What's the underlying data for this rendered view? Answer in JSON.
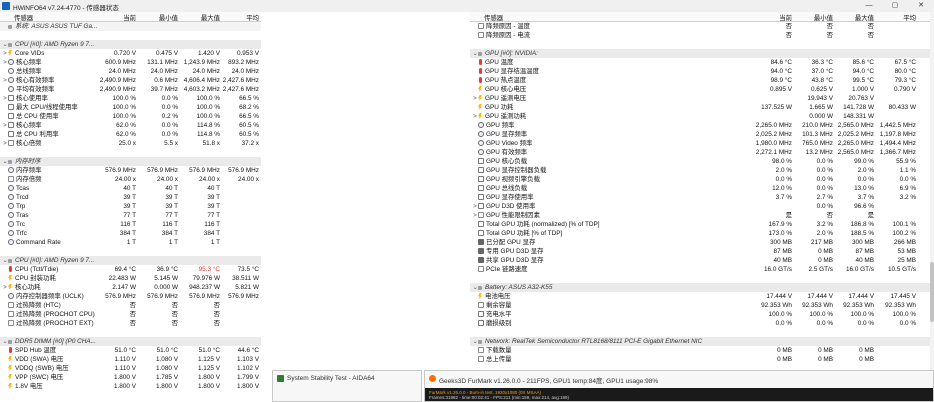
{
  "window": {
    "title": "HWiNFO64 v7.24-4770 - 传感器状态",
    "minimize": "—",
    "maximize": "▢",
    "close": "✕"
  },
  "columns": {
    "name": "传感器",
    "current": "当前",
    "min": "最小值",
    "max": "最大值",
    "avg": "平均"
  },
  "left_rows": [
    {
      "type": "group",
      "first": true,
      "icon": "computer-icon",
      "name": "系统: ASUS ASUS TUF Ga..."
    },
    {
      "type": "gap"
    },
    {
      "type": "group",
      "icon": "cpu-icon",
      "name": "CPU [#0]: AMD Ryzen 9 7...",
      "expander": "⌄"
    },
    {
      "type": "row",
      "indent": 1,
      "expander": ">",
      "icon": "bolt",
      "name": "Core VIDs",
      "v": [
        "0.720 V",
        "0.475 V",
        "1.420 V",
        "0.953 V"
      ]
    },
    {
      "type": "row",
      "indent": 1,
      "expander": ">",
      "icon": "clock",
      "name": "核心频率",
      "v": [
        "600.9 MHz",
        "131.1 MHz",
        "1,243.9 MHz",
        "893.2 MHz"
      ]
    },
    {
      "type": "row",
      "icon": "clock",
      "name": "总线频率",
      "v": [
        "24.0 MHz",
        "24.0 MHz",
        "24.0 MHz",
        "24.0 MHz"
      ]
    },
    {
      "type": "row",
      "indent": 1,
      "expander": ">",
      "icon": "clock",
      "name": "核心有效频率",
      "v": [
        "2,490.9 MHz",
        "0.6 MHz",
        "4,606.4 MHz",
        "2,427.6 MHz"
      ]
    },
    {
      "type": "row",
      "icon": "clock",
      "name": "平均有效频率",
      "v": [
        "2,490.9 MHz",
        "39.7 MHz",
        "4,603.2 MHz",
        "2,427.6 MHz"
      ]
    },
    {
      "type": "row",
      "indent": 1,
      "expander": ">",
      "icon": "pct",
      "name": "核心使用率",
      "v": [
        "100.0 %",
        "0.0 %",
        "100.0 %",
        "66.5 %"
      ]
    },
    {
      "type": "row",
      "icon": "pct",
      "name": "最大 CPU/线程使用率",
      "v": [
        "100.0 %",
        "0.0 %",
        "100.0 %",
        "68.2 %"
      ]
    },
    {
      "type": "row",
      "icon": "pct",
      "name": "总 CPU 使用率",
      "v": [
        "100.0 %",
        "0.2 %",
        "100.0 %",
        "66.5 %"
      ]
    },
    {
      "type": "row",
      "indent": 1,
      "expander": ">",
      "icon": "pct",
      "name": "核心频率",
      "v": [
        "62.0 %",
        "0.0 %",
        "114.8 %",
        "60.5 %"
      ]
    },
    {
      "type": "row",
      "icon": "pct",
      "name": "总 CPU 利用率",
      "v": [
        "62.0 %",
        "0.0 %",
        "114.8 %",
        "60.5 %"
      ]
    },
    {
      "type": "row",
      "indent": 1,
      "expander": ">",
      "icon": "box",
      "name": "核心倍频",
      "v": [
        "25.0 x",
        "5.5 x",
        "51.8 x",
        "37.2 x"
      ]
    },
    {
      "type": "gap"
    },
    {
      "type": "group",
      "icon": "memory-icon",
      "name": "内存时序",
      "expander": "⌄"
    },
    {
      "type": "row",
      "icon": "clock",
      "name": "内存频率",
      "v": [
        "576.9 MHz",
        "576.9 MHz",
        "576.9 MHz",
        "576.9 MHz"
      ]
    },
    {
      "type": "row",
      "icon": "box",
      "name": "内存倍频",
      "v": [
        "24.00 x",
        "24.00 x",
        "24.00 x",
        "24.00 x"
      ]
    },
    {
      "type": "row",
      "icon": "clock",
      "name": "Tcas",
      "v": [
        "40 T",
        "40 T",
        "40 T",
        ""
      ]
    },
    {
      "type": "row",
      "icon": "clock",
      "name": "Trcd",
      "v": [
        "39 T",
        "39 T",
        "39 T",
        ""
      ]
    },
    {
      "type": "row",
      "icon": "clock",
      "name": "Trp",
      "v": [
        "39 T",
        "39 T",
        "39 T",
        ""
      ]
    },
    {
      "type": "row",
      "icon": "clock",
      "name": "Tras",
      "v": [
        "77 T",
        "77 T",
        "77 T",
        ""
      ]
    },
    {
      "type": "row",
      "icon": "clock",
      "name": "Trc",
      "v": [
        "116 T",
        "116 T",
        "116 T",
        ""
      ]
    },
    {
      "type": "row",
      "icon": "clock",
      "name": "Trfc",
      "v": [
        "384 T",
        "384 T",
        "384 T",
        ""
      ]
    },
    {
      "type": "row",
      "icon": "clock",
      "name": "Command Rate",
      "v": [
        "1 T",
        "1 T",
        "1 T",
        ""
      ]
    },
    {
      "type": "gap"
    },
    {
      "type": "group",
      "icon": "cpu-icon",
      "name": "CPU [#0]: AMD Ryzen 9 7...",
      "expander": "⌄"
    },
    {
      "type": "row",
      "icon": "temp",
      "name": "CPU (Tctl/Tdie)",
      "v": [
        "69.4 °C",
        "36.9 °C",
        "95.3 °C",
        "73.5 °C"
      ],
      "red": 2
    },
    {
      "type": "row",
      "icon": "bolt",
      "name": "CPU 封装功耗",
      "v": [
        "22.483 W",
        "5.145 W",
        "79.976 W",
        "38.511 W"
      ]
    },
    {
      "type": "row",
      "indent": 1,
      "expander": ">",
      "icon": "bolt",
      "name": "核心功耗",
      "v": [
        "2.147 W",
        "0.000 W",
        "948.237 W",
        "5.821 W"
      ]
    },
    {
      "type": "row",
      "icon": "clock",
      "name": "内存控制器频率 (UCLK)",
      "v": [
        "576.9 MHz",
        "576.9 MHz",
        "576.9 MHz",
        "576.9 MHz"
      ]
    },
    {
      "type": "row",
      "icon": "box",
      "name": "过热降频 (HTC)",
      "v": [
        "否",
        "否",
        "否",
        ""
      ]
    },
    {
      "type": "row",
      "icon": "box",
      "name": "过热降频 (PROCHOT CPU)",
      "v": [
        "否",
        "否",
        "否",
        ""
      ]
    },
    {
      "type": "row",
      "icon": "box",
      "name": "过热降频 (PROCHOT EXT)",
      "v": [
        "否",
        "否",
        "否",
        ""
      ]
    },
    {
      "type": "gap"
    },
    {
      "type": "group",
      "icon": "memory-icon",
      "name": "DDR5 DIMM [#0] (P0 CHA...",
      "expander": "⌄"
    },
    {
      "type": "row",
      "icon": "temp",
      "name": "SPD Hub 温度",
      "v": [
        "51.0 °C",
        "51.0 °C",
        "51.0 °C",
        "44.6 °C"
      ]
    },
    {
      "type": "row",
      "icon": "bolt",
      "name": "VDD (SWA) 电压",
      "v": [
        "1.110 V",
        "1.080 V",
        "1.125 V",
        "1.103 V"
      ]
    },
    {
      "type": "row",
      "icon": "bolt",
      "name": "VDDQ (SWB) 电压",
      "v": [
        "1.110 V",
        "1.080 V",
        "1.125 V",
        "1.102 V"
      ]
    },
    {
      "type": "row",
      "icon": "bolt",
      "name": "VPP (SWC) 电压",
      "v": [
        "1.800 V",
        "1.785 V",
        "1.800 V",
        "1.799 V"
      ]
    },
    {
      "type": "row",
      "icon": "bolt",
      "name": "1.8V 电压",
      "v": [
        "1.800 V",
        "1.800 V",
        "1.800 V",
        "1.800 V"
      ]
    }
  ],
  "right_rows": [
    {
      "type": "header",
      "name": "传感器",
      "v": [
        "当前",
        "最小值",
        "最大值",
        "平均"
      ]
    },
    {
      "type": "row",
      "indent": 1,
      "icon": "box",
      "name": "降频原因 - 温度",
      "v": [
        "否",
        "否",
        "否",
        ""
      ]
    },
    {
      "type": "row",
      "indent": 1,
      "icon": "box",
      "name": "降频原因 - 电流",
      "v": [
        "否",
        "否",
        "否",
        ""
      ]
    },
    {
      "type": "gap"
    },
    {
      "type": "group",
      "icon": "gpu-icon",
      "name": "GPU [#0]: NVIDIA:",
      "expander": "⌄"
    },
    {
      "type": "row",
      "icon": "temp",
      "name": "GPU 温度",
      "v": [
        "84.6 °C",
        "36.3 °C",
        "85.6 °C",
        "67.5 °C"
      ]
    },
    {
      "type": "row",
      "icon": "temp",
      "name": "GPU 显存结温温度",
      "v": [
        "94.0 °C",
        "37.0 °C",
        "94.0 °C",
        "80.0 °C"
      ]
    },
    {
      "type": "row",
      "icon": "temp",
      "name": "GPU 热点温度",
      "v": [
        "98.9 °C",
        "43.8 °C",
        "99.5 °C",
        "79.3 °C"
      ]
    },
    {
      "type": "row",
      "icon": "bolt",
      "name": "GPU 核心电压",
      "v": [
        "0.895 V",
        "0.625 V",
        "1.000 V",
        "0.790 V"
      ]
    },
    {
      "type": "row",
      "indent": 1,
      "expander": ">",
      "icon": "bolt",
      "name": "GPU 遥测电压",
      "v": [
        "",
        "19.943 V",
        "20.763 V",
        ""
      ]
    },
    {
      "type": "row",
      "icon": "bolt",
      "name": "GPU 功耗",
      "v": [
        "137.525 W",
        "1.665 W",
        "141.728 W",
        "80.433 W"
      ]
    },
    {
      "type": "row",
      "indent": 1,
      "expander": ">",
      "icon": "bolt",
      "name": "GPU 遥测功耗",
      "v": [
        "",
        "0.000 W",
        "148.331 W",
        ""
      ]
    },
    {
      "type": "row",
      "icon": "clock",
      "name": "GPU 频率",
      "v": [
        "2,265.0 MHz",
        "210.0 MHz",
        "2,565.0 MHz",
        "1,442.5 MHz"
      ]
    },
    {
      "type": "row",
      "icon": "clock",
      "name": "GPU 显存频率",
      "v": [
        "2,025.2 MHz",
        "101.3 MHz",
        "2,025.2 MHz",
        "1,197.8 MHz"
      ]
    },
    {
      "type": "row",
      "icon": "clock",
      "name": "GPU Video 频率",
      "v": [
        "1,980.0 MHz",
        "765.0 MHz",
        "2,265.0 MHz",
        "1,494.4 MHz"
      ]
    },
    {
      "type": "row",
      "icon": "clock",
      "name": "GPU 有效频率",
      "v": [
        "2,272.1 MHz",
        "13.2 MHz",
        "2,565.0 MHz",
        "1,366.7 MHz"
      ]
    },
    {
      "type": "row",
      "icon": "pct",
      "name": "GPU 核心负载",
      "v": [
        "98.0 %",
        "0.0 %",
        "99.0 %",
        "55.9 %"
      ]
    },
    {
      "type": "row",
      "icon": "pct",
      "name": "GPU 显存控制器负载",
      "v": [
        "2.0 %",
        "0.0 %",
        "2.0 %",
        "1.1 %"
      ]
    },
    {
      "type": "row",
      "icon": "pct",
      "name": "GPU 视频引擎负载",
      "v": [
        "0.0 %",
        "0.0 %",
        "0.0 %",
        "0.0 %"
      ]
    },
    {
      "type": "row",
      "icon": "pct",
      "name": "GPU 总线负载",
      "v": [
        "12.0 %",
        "0.0 %",
        "13.0 %",
        "6.9 %"
      ]
    },
    {
      "type": "row",
      "icon": "pct",
      "name": "GPU 显存使用率",
      "v": [
        "3.7 %",
        "2.7 %",
        "3.7 %",
        "3.2 %"
      ]
    },
    {
      "type": "row",
      "indent": 1,
      "expander": ">",
      "icon": "pct",
      "name": "GPU D3D 使用率",
      "v": [
        "",
        "0.0 %",
        "96.6 %",
        ""
      ]
    },
    {
      "type": "row",
      "indent": 1,
      "expander": ">",
      "icon": "box",
      "name": "GPU 性能限制因素",
      "v": [
        "是",
        "否",
        "是",
        ""
      ]
    },
    {
      "type": "row",
      "icon": "pct",
      "name": "Total GPU 功耗 (normalized) [% of TDP]",
      "v": [
        "167.9 %",
        "3.2 %",
        "186.8 %",
        "100.1 %"
      ]
    },
    {
      "type": "row",
      "icon": "pct",
      "name": "Total GPU 功耗 [% of TDP]",
      "v": [
        "173.0 %",
        "2.0 %",
        "188.5 %",
        "100.2 %"
      ]
    },
    {
      "type": "row",
      "icon": "chip",
      "name": "已分配 GPU 显存",
      "v": [
        "300 MB",
        "217 MB",
        "300 MB",
        "266 MB"
      ]
    },
    {
      "type": "row",
      "icon": "chip",
      "name": "专用 GPU D3D 显存",
      "v": [
        "87 MB",
        "0 MB",
        "87 MB",
        "53 MB"
      ]
    },
    {
      "type": "row",
      "icon": "chip",
      "name": "共享 GPU D3D 显存",
      "v": [
        "40 MB",
        "0 MB",
        "40 MB",
        "25 MB"
      ]
    },
    {
      "type": "row",
      "icon": "box",
      "name": "PCIe 链路速度",
      "v": [
        "16.0 GT/s",
        "2.5 GT/s",
        "16.0 GT/s",
        "10.5 GT/s"
      ]
    },
    {
      "type": "gap"
    },
    {
      "type": "group",
      "icon": "battery-icon",
      "name": "Battery: ASUS A32-K55",
      "expander": "⌄"
    },
    {
      "type": "row",
      "icon": "bolt",
      "name": "电池电压",
      "v": [
        "17.444 V",
        "17.444 V",
        "17.444 V",
        "17.445 V"
      ]
    },
    {
      "type": "row",
      "icon": "box",
      "name": "剩余容量",
      "v": [
        "92.353 Wh",
        "92.353 Wh",
        "92.353 Wh",
        "92.353 Wh"
      ]
    },
    {
      "type": "row",
      "icon": "pct",
      "name": "充电水平",
      "v": [
        "100.0 %",
        "100.0 %",
        "100.0 %",
        "100.0 %"
      ]
    },
    {
      "type": "row",
      "icon": "pct",
      "name": "磨损级别",
      "v": [
        "0.0 %",
        "0.0 %",
        "0.0 %",
        "0.0 %"
      ]
    },
    {
      "type": "gap"
    },
    {
      "type": "group",
      "icon": "network-icon",
      "name": "Network: RealTek Semiconductor RTL8168/8111 PCI-E Gigabit Ethernet NIC",
      "expander": "⌄"
    },
    {
      "type": "row",
      "icon": "box",
      "name": "下载数量",
      "v": [
        "0 MB",
        "0 MB",
        "0 MB",
        ""
      ]
    },
    {
      "type": "row",
      "icon": "box",
      "name": "总上传量",
      "v": [
        "0 MB",
        "0 MB",
        "0 MB",
        ""
      ]
    }
  ],
  "taskbar": {
    "aida_title": "System Stability Test - AIDA64",
    "furmark_title": "Geeks3D FurMark v1.26.0.0 - 211FPS, GPU1 temp:84度, GPU1 usage:98%",
    "furmark_line1": "FurMark v1.26.0.0 - Burn-in test, 1920x1080 (0X MSAA)",
    "furmark_line2": "Frames:31982 - time:00:02:41 - FPS:211 (min:159, max:214, avg:199)"
  },
  "colors": {
    "red_value": "#e53935",
    "group_bg": "#eaeaea",
    "accent": "#1565c0"
  }
}
